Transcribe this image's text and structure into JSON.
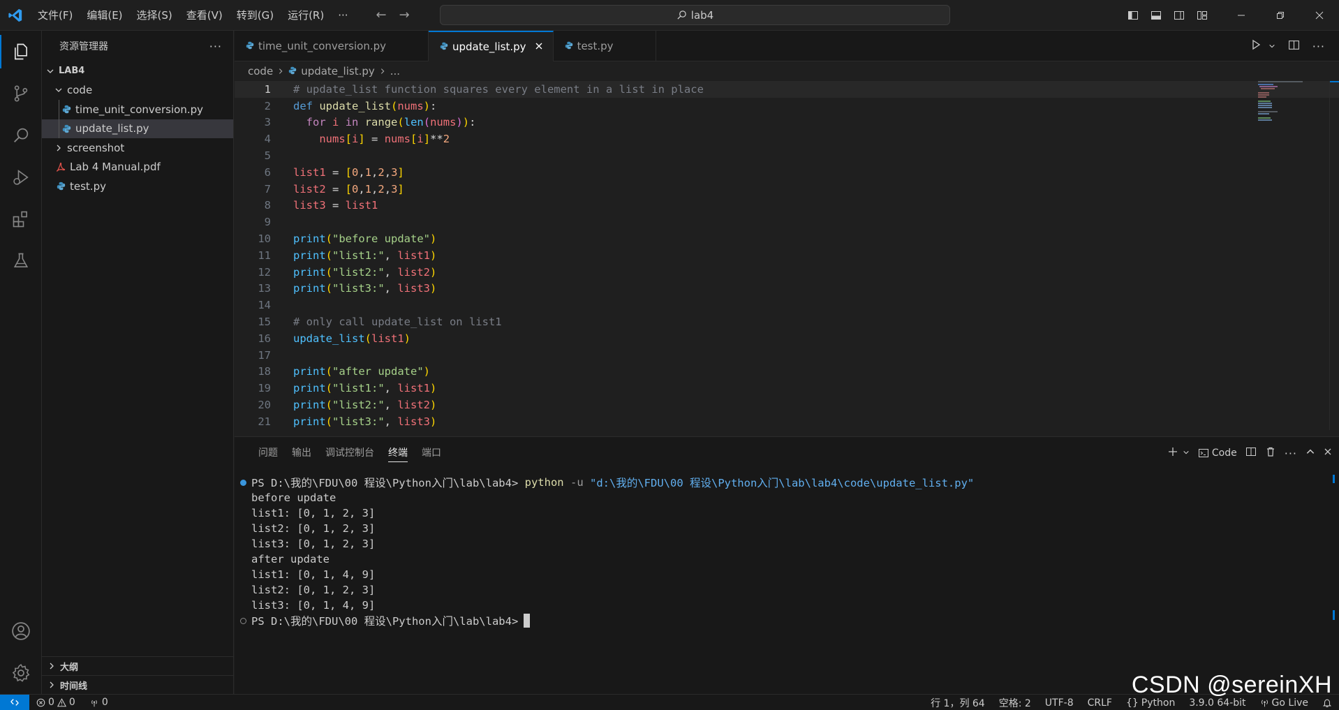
{
  "titlebar": {
    "menu": [
      "文件(F)",
      "编辑(E)",
      "选择(S)",
      "查看(V)",
      "转到(G)",
      "运行(R)",
      "···"
    ],
    "search_text": "lab4"
  },
  "sidebar": {
    "title": "资源管理器",
    "more": "···",
    "root": "LAB4",
    "tree": [
      {
        "label": "code",
        "type": "folder-open",
        "level": 1
      },
      {
        "label": "time_unit_conversion.py",
        "type": "python",
        "level": 2
      },
      {
        "label": "update_list.py",
        "type": "python",
        "level": 2,
        "selected": true
      },
      {
        "label": "screenshot",
        "type": "folder-closed",
        "level": 1
      },
      {
        "label": "Lab 4 Manual.pdf",
        "type": "pdf",
        "level": 1
      },
      {
        "label": "test.py",
        "type": "python",
        "level": 1
      }
    ],
    "outline": "大纲",
    "timeline": "时间线"
  },
  "tabs": [
    {
      "label": "time_unit_conversion.py"
    },
    {
      "label": "update_list.py",
      "active": true
    },
    {
      "label": "test.py"
    }
  ],
  "breadcrumb": {
    "folder": "code",
    "file": "update_list.py",
    "more": "..."
  },
  "editor": {
    "line_numbers": [
      "1",
      "2",
      "3",
      "4",
      "5",
      "6",
      "7",
      "8",
      "9",
      "10",
      "11",
      "12",
      "13",
      "14",
      "15",
      "16",
      "17",
      "18",
      "19",
      "20",
      "21"
    ]
  },
  "panel": {
    "tabs": [
      "问题",
      "输出",
      "调试控制台",
      "终端",
      "端口"
    ],
    "active_tab": "终端",
    "terminal_label": "Code",
    "prompt": "PS D:\\我的\\FDU\\00 程设\\Python入门\\lab\\lab4>",
    "cmd": "python",
    "flag": "-u",
    "path": "\"d:\\我的\\FDU\\00 程设\\Python入门\\lab\\lab4\\code\\update_list.py\"",
    "output": [
      "before update",
      "list1: [0, 1, 2, 3]",
      "list2: [0, 1, 2, 3]",
      "list3: [0, 1, 2, 3]",
      "after update",
      "list1: [0, 1, 4, 9]",
      "list2: [0, 1, 2, 3]",
      "list3: [0, 1, 4, 9]"
    ]
  },
  "statusbar": {
    "errors": "0",
    "warnings": "0",
    "ports": "0",
    "position": "行 1，列 64",
    "spaces": "空格: 2",
    "encoding": "UTF-8",
    "eol": "CRLF",
    "language": "Python",
    "interpreter": "3.9.0 64-bit",
    "golive": "Go Live"
  },
  "watermark": "CSDN @sereinXH",
  "colors": {
    "accent": "#0078d4",
    "bg": "#1f1f1f",
    "sidebar": "#181818"
  }
}
